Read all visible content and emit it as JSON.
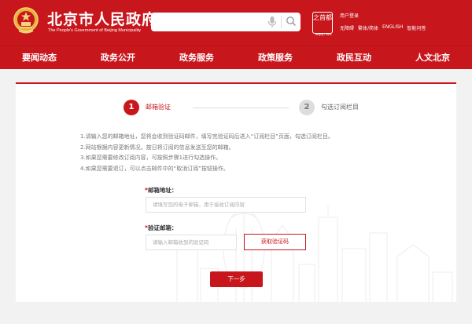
{
  "header": {
    "title": "北京市人民政府",
    "subtitle": "The People's Government of Beijing Municipality",
    "search_placeholder": "",
    "capital_logo_text": "之首都",
    "capital_logo_caption": "Beijing China",
    "user_login": "用户登录",
    "links": [
      "无障碍",
      "繁体/简体",
      "ENGLISH",
      "智能问答"
    ],
    "brand_color": "#c8161d"
  },
  "nav": {
    "items": [
      "要闻动态",
      "政务公开",
      "政务服务",
      "政策服务",
      "政民互动",
      "人文北京"
    ]
  },
  "steps": {
    "step1_number": "1",
    "step1_label": "邮箱验证",
    "step2_number": "2",
    "step2_label": "勾选订阅栏目"
  },
  "instructions": [
    "1.请输入您的邮箱地址，您将会收到验证码邮件，填写完验证码后进入“订阅栏目”页面，勾选订阅栏目。",
    "2.网站根据内容更新情况，按日将订阅的信息发送至您的邮箱。",
    "3.如果您需要修改订阅内容，可按照步骤1进行勾选操作。",
    "4.如果您需要退订，可以点击邮件中的“取消订阅”按钮操作。"
  ],
  "form": {
    "required_mark": "*",
    "email_label": "邮箱地址：",
    "email_placeholder": "请填写您的电子邮箱，用于接收订阅内容",
    "email_value": "",
    "code_label": "验证邮箱：",
    "code_placeholder": "请输入邮箱收到的验证码",
    "code_value": "",
    "get_code_label": "获取验证码",
    "next_label": "下一步"
  }
}
